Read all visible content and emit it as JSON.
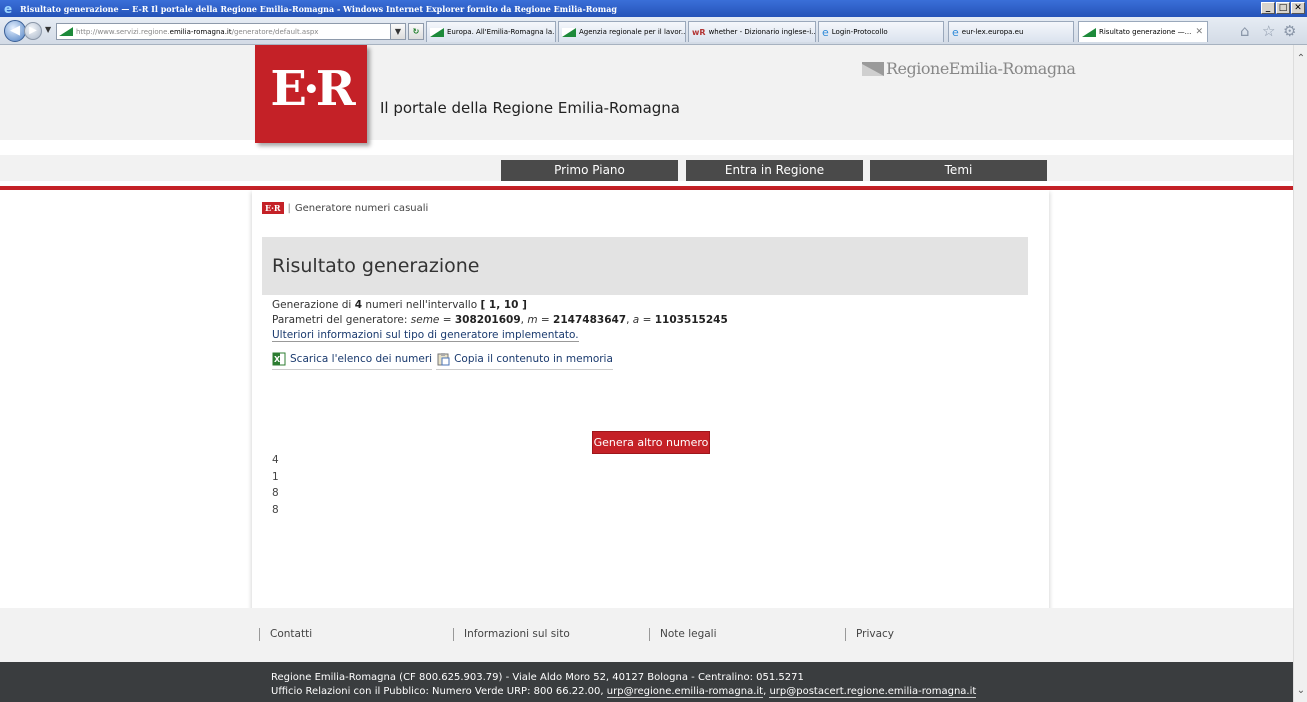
{
  "window": {
    "title": "Risultato generazione — E-R Il portale della Regione Emilia-Romagna - Windows Internet Explorer fornito da Regione Emilia-Romag",
    "min_glyph": "_",
    "max_glyph": "□",
    "close_glyph": "✕"
  },
  "browser": {
    "address_prefix": "http://www.servizi.regione.",
    "address_host": "emilia-romagna.it",
    "address_suffix": "/generatore/default.aspx",
    "tabs": [
      {
        "label": "Europa. All'Emilia-Romagna la..."
      },
      {
        "label": "Agenzia regionale per il lavor..."
      },
      {
        "label": "whether - Dizionario inglese-i..."
      },
      {
        "label": "Login-Protocollo"
      },
      {
        "label": "eur-lex.europa.eu"
      },
      {
        "label": "Risultato generazione —..."
      }
    ]
  },
  "header": {
    "logo_text": "E·R",
    "portal_title": "Il portale della Regione Emilia-Romagna",
    "region_name": "RegioneEmilia-Romagna"
  },
  "menu": {
    "items": [
      {
        "label": "Primo Piano"
      },
      {
        "label": "Entra in Regione"
      },
      {
        "label": "Temi"
      }
    ]
  },
  "breadcrumb": {
    "logo_text": "E·R",
    "separator": "|",
    "current": "Generatore numeri casuali"
  },
  "result": {
    "title": "Risultato generazione",
    "gen_prefix": "Generazione di ",
    "gen_count": "4",
    "gen_mid": " numeri nell'intervallo ",
    "gen_interval": "[ 1, 10 ]",
    "params_prefix": "Parametri del generatore: ",
    "seme_label": "seme",
    "seme_value": "308201609",
    "m_label": "m",
    "m_value": "2147483647",
    "a_label": "a",
    "a_value": "1103515245",
    "more_info_link": "Ulteriori informazioni sul tipo di generatore implementato.",
    "download_label": "Scarica l'elenco dei numeri",
    "copy_label": "Copia il contenuto in memoria",
    "generate_button": "Genera altro numero",
    "numbers": [
      "4",
      "1",
      "8",
      "8"
    ]
  },
  "footer": {
    "links": [
      {
        "label": "Contatti"
      },
      {
        "label": "Informazioni sul sito"
      },
      {
        "label": "Note legali"
      },
      {
        "label": "Privacy"
      }
    ],
    "line1": "Regione Emilia-Romagna (CF 800.625.903.79) - Viale Aldo Moro 52, 40127 Bologna - Centralino: 051.5271",
    "line2_prefix": "Ufficio Relazioni con il Pubblico: Numero Verde URP: 800 66.22.00, ",
    "email1": "urp@regione.emilia-romagna.it",
    "line2_sep": ", ",
    "email2": "urp@postacert.regione.emilia-romagna.it"
  },
  "colors": {
    "brand_red": "#c42127",
    "menu_dark": "#4a4a4a",
    "footer_dark": "#3a3d3f"
  }
}
